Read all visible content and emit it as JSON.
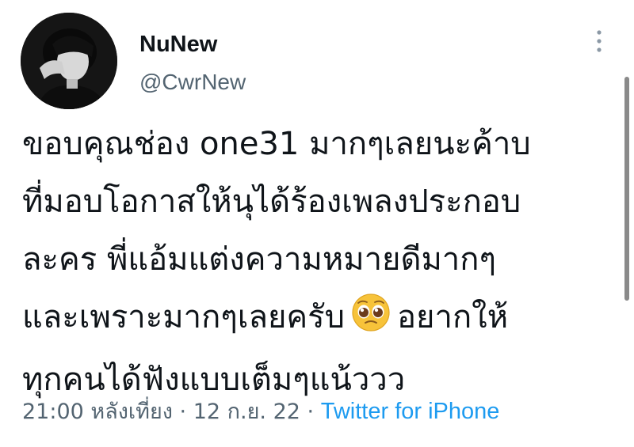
{
  "tweet": {
    "author": {
      "display_name": "NuNew",
      "handle": "@CwrNew"
    },
    "text_lines": [
      "ขอบคุณช่อง one31 มากๆเลยนะค้าบ",
      "ที่มอบโอกาสให้นุได้ร้องเพลงประกอบ",
      "ละคร พี่แอ้มแต่งความหมายดีมากๆ",
      "และเพราะมากๆเลยครับ",
      "อยากให้",
      "ทุกคนได้ฟังแบบเต็มๆแน้ววว"
    ],
    "emoji_icon": "pleading-face-emoji",
    "time": "21:00 หลังเที่ยง",
    "separator": "·",
    "date": "12 ก.ย. 22",
    "source": "Twitter for iPhone"
  },
  "colors": {
    "text": "#0f1419",
    "secondary": "#536471",
    "link": "#1d9bf0",
    "emoji_face": "#f7c33a"
  }
}
